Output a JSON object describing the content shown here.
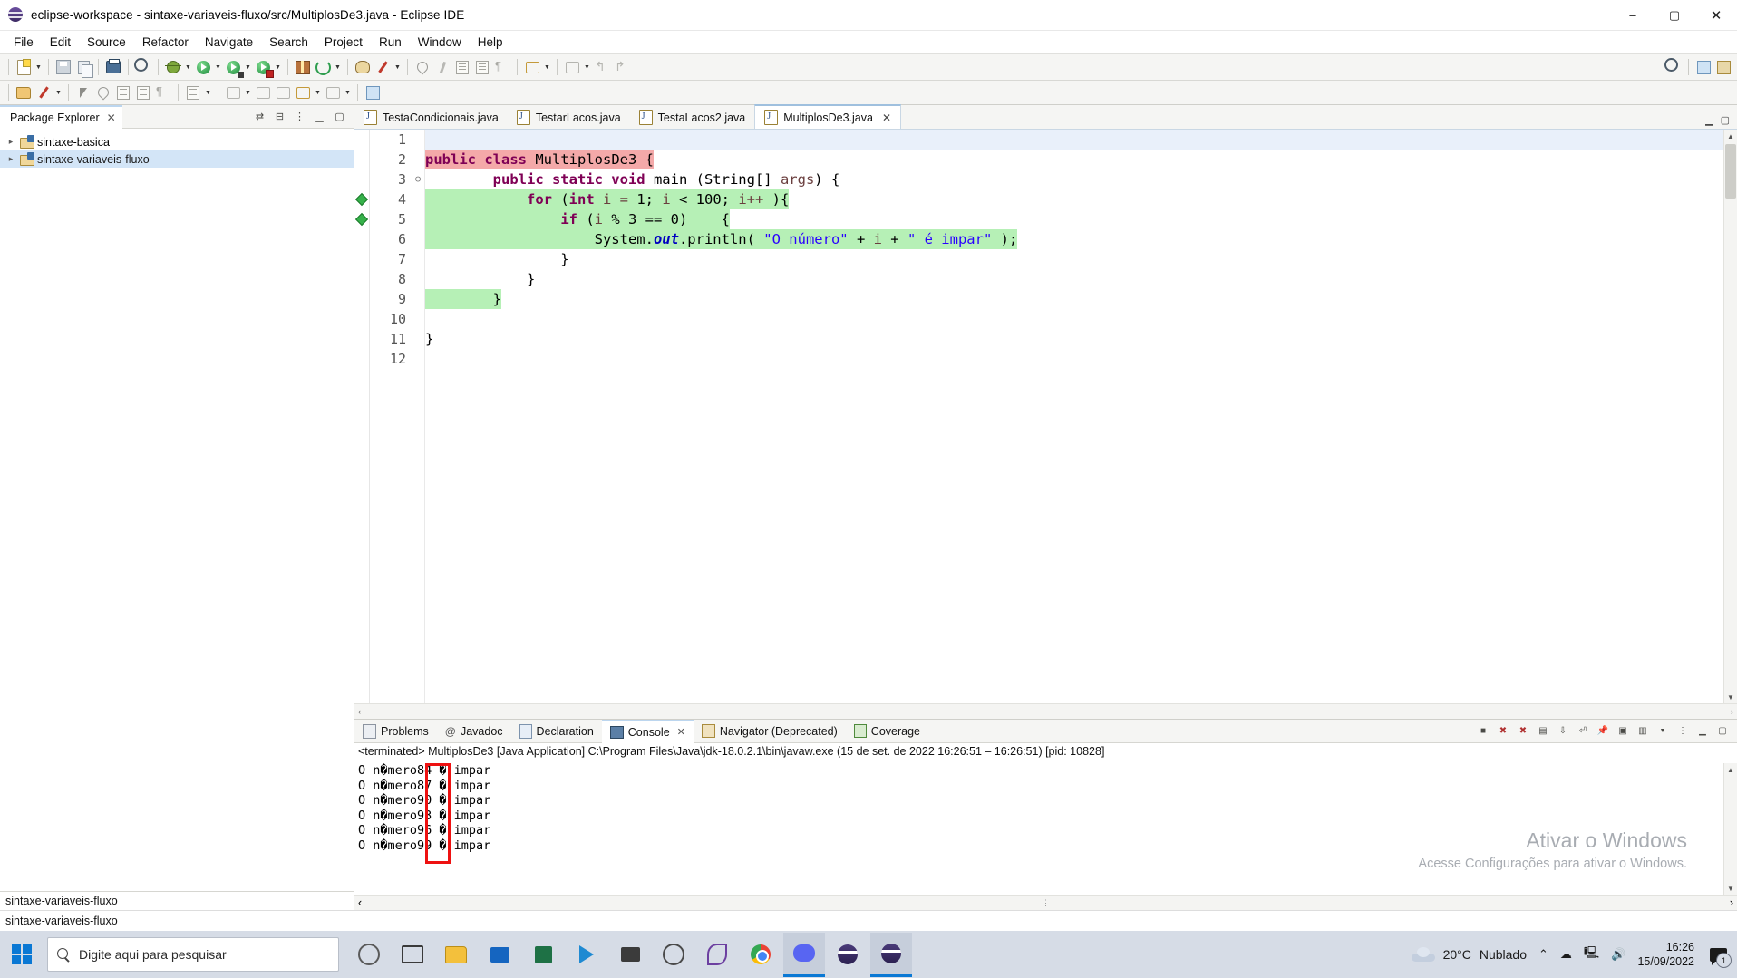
{
  "window": {
    "title": "eclipse-workspace - sintaxe-variaveis-fluxo/src/MultiplosDe3.java - Eclipse IDE",
    "app_icon": "eclipse-globe-icon",
    "minimize": "–",
    "maximize": "▢",
    "close": "✕"
  },
  "menubar": [
    "File",
    "Edit",
    "Source",
    "Refactor",
    "Navigate",
    "Search",
    "Project",
    "Run",
    "Window",
    "Help"
  ],
  "toolbar": {
    "groups": [
      [
        "new-wizard-icon",
        "dropdown"
      ],
      [
        "save-icon",
        "save-all-icon"
      ],
      [
        "print-icon"
      ],
      [
        "search-icon"
      ],
      [
        "debug-icon",
        "dropdown"
      ],
      [
        "run-icon",
        "dropdown"
      ],
      [
        "run-coverage-icon",
        "dropdown"
      ],
      [
        "run-external-tools-icon",
        "dropdown"
      ],
      [
        "new-package-icon",
        "refresh-icon",
        "dropdown"
      ],
      [
        "open-type-icon",
        "pen-icon",
        "dropdown"
      ],
      [
        "pin-editor-icon",
        "brush-icon",
        "outline-icon",
        "list-icon",
        "paragraph-icon"
      ],
      [
        "next-annotation-icon",
        "dropdown"
      ],
      [
        "previous-annotation-icon",
        "dropdown"
      ],
      [
        "back-icon",
        "forward-icon",
        "forward-to-icon",
        "dropdown"
      ],
      [
        "toggle-mark-occurrences-icon",
        "dropdown"
      ],
      [
        "perspective-icon"
      ]
    ],
    "row2": [
      "open-folder-icon",
      "pen-icon",
      "dropdown",
      "pointer-icon",
      "erase-icon",
      "export-icon",
      "list-icon",
      "paragraph-icon",
      "outline-icon",
      "dropdown",
      "tag-icon",
      "dropdown",
      "left-tag-icon",
      "right-tag-icon",
      "filled-tag-icon",
      "dropdown",
      "ghost-tag-icon",
      "dropdown",
      "perspective-icon"
    ],
    "search_right": "search-icon"
  },
  "package_explorer": {
    "tab_label": "Package Explorer",
    "tab_icon": "package-explorer-icon",
    "close_icon": "✕",
    "tools": [
      "link-with-editor-icon",
      "collapse-all-icon",
      "view-menu-icon",
      "minimize-icon",
      "maximize-icon"
    ],
    "tree": [
      {
        "label": "sintaxe-basica",
        "arrow": "▸",
        "selected": false
      },
      {
        "label": "sintaxe-variaveis-fluxo",
        "arrow": "▸",
        "selected": true
      }
    ]
  },
  "editor": {
    "tabs": [
      {
        "label": "TestaCondicionais.java",
        "active": false,
        "closable": false
      },
      {
        "label": "TestarLacos.java",
        "active": false,
        "closable": false
      },
      {
        "label": "TestaLacos2.java",
        "active": false,
        "closable": false
      },
      {
        "label": "MultiplosDe3.java",
        "active": true,
        "closable": true,
        "close_icon": "✕"
      }
    ],
    "tools": [
      "minimize-icon",
      "maximize-icon"
    ],
    "lines": [
      {
        "num": "1",
        "marker": "",
        "fold": "",
        "highlight": "caret",
        "tokens": []
      },
      {
        "num": "2",
        "marker": "",
        "fold": "",
        "highlight": "red",
        "tokens": [
          {
            "t": "public ",
            "c": "kw"
          },
          {
            "t": "class ",
            "c": "kw"
          },
          {
            "t": "MultiplosDe3 {",
            "c": "plain"
          }
        ]
      },
      {
        "num": "3",
        "marker": "",
        "fold": "⊖",
        "highlight": "none",
        "tokens": [
          {
            "t": "        ",
            "c": "plain"
          },
          {
            "t": "public static void ",
            "c": "kw"
          },
          {
            "t": "main (String[] ",
            "c": "plain"
          },
          {
            "t": "args",
            "c": "par"
          },
          {
            "t": ") {",
            "c": "plain"
          }
        ]
      },
      {
        "num": "4",
        "marker": "diamond",
        "fold": "",
        "highlight": "green",
        "tokens": [
          {
            "t": "            ",
            "c": "plain"
          },
          {
            "t": "for ",
            "c": "kw"
          },
          {
            "t": "(",
            "c": "plain"
          },
          {
            "t": "int ",
            "c": "kw"
          },
          {
            "t": "i = ",
            "c": "par"
          },
          {
            "t": "1",
            "c": "plain"
          },
          {
            "t": "; ",
            "c": "plain"
          },
          {
            "t": "i ",
            "c": "par"
          },
          {
            "t": "< ",
            "c": "plain"
          },
          {
            "t": "100",
            "c": "plain"
          },
          {
            "t": "; ",
            "c": "plain"
          },
          {
            "t": "i++",
            "c": "par"
          },
          {
            "t": " ){",
            "c": "plain"
          }
        ]
      },
      {
        "num": "5",
        "marker": "diamond",
        "fold": "",
        "highlight": "green",
        "tokens": [
          {
            "t": "                ",
            "c": "plain"
          },
          {
            "t": "if ",
            "c": "kw"
          },
          {
            "t": "(",
            "c": "plain"
          },
          {
            "t": "i ",
            "c": "par"
          },
          {
            "t": "% ",
            "c": "plain"
          },
          {
            "t": "3 ",
            "c": "plain"
          },
          {
            "t": "== ",
            "c": "plain"
          },
          {
            "t": "0",
            "c": "plain"
          },
          {
            "t": ")    {",
            "c": "plain"
          }
        ]
      },
      {
        "num": "6",
        "marker": "",
        "fold": "",
        "highlight": "green",
        "tokens": [
          {
            "t": "                    ",
            "c": "plain"
          },
          {
            "t": "System.",
            "c": "plain"
          },
          {
            "t": "out",
            "c": "fld"
          },
          {
            "t": ".println( ",
            "c": "plain"
          },
          {
            "t": "\"O número\"",
            "c": "str"
          },
          {
            "t": " + ",
            "c": "plain"
          },
          {
            "t": "i",
            "c": "par"
          },
          {
            "t": " + ",
            "c": "plain"
          },
          {
            "t": "\" é impar\"",
            "c": "str"
          },
          {
            "t": " );",
            "c": "plain"
          }
        ]
      },
      {
        "num": "7",
        "marker": "",
        "fold": "",
        "highlight": "none",
        "tokens": [
          {
            "t": "                }",
            "c": "plain"
          }
        ]
      },
      {
        "num": "8",
        "marker": "",
        "fold": "",
        "highlight": "none",
        "tokens": [
          {
            "t": "            }",
            "c": "plain"
          }
        ]
      },
      {
        "num": "9",
        "marker": "",
        "fold": "",
        "highlight": "green-short",
        "tokens": [
          {
            "t": "        }",
            "c": "plain"
          }
        ]
      },
      {
        "num": "10",
        "marker": "",
        "fold": "",
        "highlight": "none",
        "tokens": []
      },
      {
        "num": "11",
        "marker": "",
        "fold": "",
        "highlight": "none",
        "tokens": [
          {
            "t": "}",
            "c": "plain"
          }
        ]
      },
      {
        "num": "12",
        "marker": "",
        "fold": "",
        "highlight": "none",
        "tokens": []
      }
    ],
    "scroll_left_arrow": "‹",
    "scroll_right_arrow": "›"
  },
  "console_panel": {
    "tabs": [
      {
        "label": "Problems",
        "icon": "problems-icon",
        "active": false
      },
      {
        "label": "Javadoc",
        "icon": "javadoc-icon",
        "active": false
      },
      {
        "label": "Declaration",
        "icon": "declaration-icon",
        "active": false
      },
      {
        "label": "Console",
        "icon": "console-icon",
        "active": true,
        "close_icon": "✕"
      },
      {
        "label": "Navigator (Deprecated)",
        "icon": "navigator-icon",
        "active": false
      },
      {
        "label": "Coverage",
        "icon": "coverage-icon",
        "active": false
      }
    ],
    "tools": [
      "terminate-icon",
      "remove-launch-icon",
      "remove-all-terminated-icon",
      "clear-console-icon",
      "scroll-lock-icon",
      "word-wrap-icon",
      "pin-console-icon",
      "display-selected-console-icon",
      "open-console-icon",
      "dropdown",
      "view-menu-icon",
      "minimize-icon",
      "maximize-icon"
    ],
    "header": "<terminated> MultiplosDe3 [Java Application] C:\\Program Files\\Java\\jdk-18.0.2.1\\bin\\javaw.exe  (15 de set. de 2022 16:26:51 – 16:26:51) [pid: 10828]",
    "output": [
      "O n�mero84 � impar",
      "O n�mero87 � impar",
      "O n�mero90 � impar",
      "O n�mero93 � impar",
      "O n�mero96 � impar",
      "O n�mero99 � impar"
    ],
    "annotation": "red-rectangle-highlight"
  },
  "watermark": {
    "line1": "Ativar o Windows",
    "line2": "Acesse Configurações para ativar o Windows."
  },
  "statusbar": {
    "text": "sintaxe-variaveis-fluxo"
  },
  "taskbar": {
    "start_icon": "windows-start-icon",
    "search_placeholder": "Digite aqui para pesquisar",
    "search_icon": "search-icon",
    "apps": [
      {
        "name": "cortana-icon",
        "active": false
      },
      {
        "name": "task-view-icon",
        "active": false
      },
      {
        "name": "file-explorer-icon",
        "active": false
      },
      {
        "name": "outlook-icon",
        "active": false
      },
      {
        "name": "excel-icon",
        "active": false
      },
      {
        "name": "vscode-icon",
        "active": false
      },
      {
        "name": "media-player-icon",
        "active": false
      },
      {
        "name": "clock-icon",
        "active": false
      },
      {
        "name": "dbeaver-icon",
        "active": false
      },
      {
        "name": "chrome-icon",
        "active": false
      },
      {
        "name": "discord-icon",
        "active": true
      },
      {
        "name": "eclipse-icon-2",
        "active": false
      },
      {
        "name": "eclipse-icon",
        "active": true
      }
    ],
    "weather_temp": "20°C",
    "weather_desc": "Nublado",
    "tray": [
      "chevron-up-icon",
      "onedrive-icon",
      "network-icon",
      "volume-icon"
    ],
    "time": "16:26",
    "date": "15/09/2022",
    "notification_count": "1"
  }
}
